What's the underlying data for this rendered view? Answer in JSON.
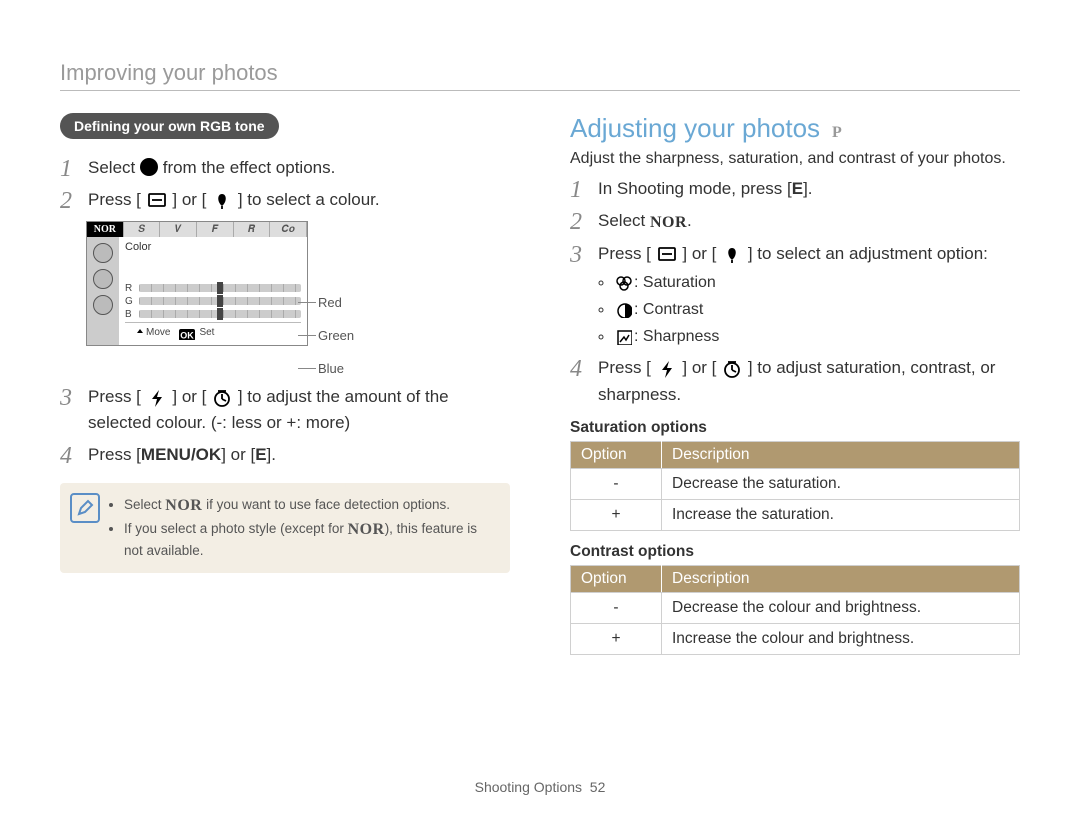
{
  "header": {
    "breadcrumb": "Improving your photos"
  },
  "left": {
    "pill": "Defining your own RGB tone",
    "step1_a": "Select ",
    "step1_b": " from the effect options.",
    "step2_a": "Press [",
    "step2_mid": "] or [",
    "step2_b": "] to select a colour.",
    "lcd": {
      "top_first": "NOR",
      "color_label": "Color",
      "rows": [
        {
          "key": "R",
          "legend": "Red"
        },
        {
          "key": "G",
          "legend": "Green"
        },
        {
          "key": "B",
          "legend": "Blue"
        }
      ],
      "bottom_move": "Move",
      "bottom_set": "Set"
    },
    "step3_a": "Press [",
    "step3_mid": "] or [",
    "step3_b": "] to adjust the amount of the selected colour. (-: less or +: more)",
    "step4_a": "Press [",
    "step4_menu": "MENU/OK",
    "step4_b": "] or [",
    "step4_e": "E",
    "step4_c": "].",
    "note1_a": "Select ",
    "note1_b": " if you want to use face detection options.",
    "note2_a": "If you select a photo style (except for ",
    "note2_b": "), this feature is not available."
  },
  "right": {
    "title": "Adjusting your photos",
    "mode": "P",
    "intro": "Adjust the sharpness, saturation, and contrast of your photos.",
    "step1_a": "In Shooting mode, press [",
    "step1_e": "E",
    "step1_b": "].",
    "step2_a": "Select ",
    "step2_b": ".",
    "step3_a": "Press [",
    "step3_mid": "] or [",
    "step3_b": "] to select an adjustment option:",
    "bullets": {
      "sat": ": Saturation",
      "con": ": Contrast",
      "shp": ": Sharpness"
    },
    "step4_a": "Press [",
    "step4_mid": "] or [",
    "step4_b": "] to adjust saturation, contrast, or sharpness.",
    "sat_options_head": "Saturation options",
    "con_options_head": "Contrast options",
    "th_opt": "Option",
    "th_desc": "Description",
    "sat_rows": [
      {
        "opt": "-",
        "desc": "Decrease the saturation."
      },
      {
        "opt": "+",
        "desc": "Increase the saturation."
      }
    ],
    "con_rows": [
      {
        "opt": "-",
        "desc": "Decrease the colour and brightness."
      },
      {
        "opt": "+",
        "desc": "Increase the colour and brightness."
      }
    ]
  },
  "footer": {
    "section": "Shooting Options",
    "page": "52"
  }
}
